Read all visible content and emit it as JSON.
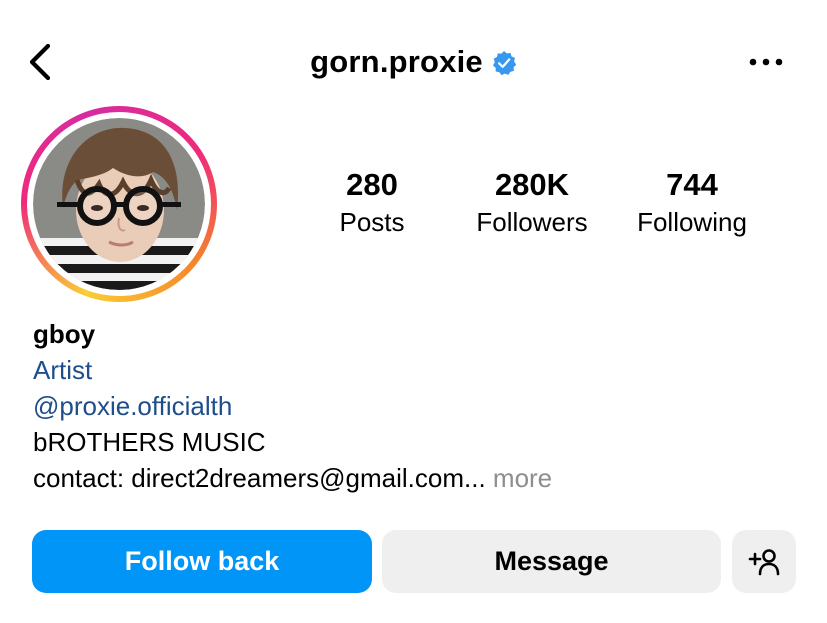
{
  "header": {
    "username": "gorn.proxie",
    "verified": true,
    "back_icon": "chevron-left-icon",
    "more_icon": "more-horizontal-icon"
  },
  "stats": [
    {
      "value": "280",
      "label": "Posts"
    },
    {
      "value": "280K",
      "label": "Followers"
    },
    {
      "value": "744",
      "label": "Following"
    }
  ],
  "bio": {
    "name": "gboy",
    "category": "Artist",
    "handle": "@proxie.officialth",
    "line1": "bROTHERS MUSIC",
    "contact": "contact: direct2dreamers@gmail.com...",
    "more": "more"
  },
  "actions": {
    "follow_back": "Follow back",
    "message": "Message",
    "add_user_icon": "add-person-icon"
  },
  "colors": {
    "primary_button": "#0095f6",
    "secondary_button": "#efefef",
    "link": "#1e4e8c",
    "verified_badge": "#3897f0",
    "muted": "#8e8e8e"
  }
}
